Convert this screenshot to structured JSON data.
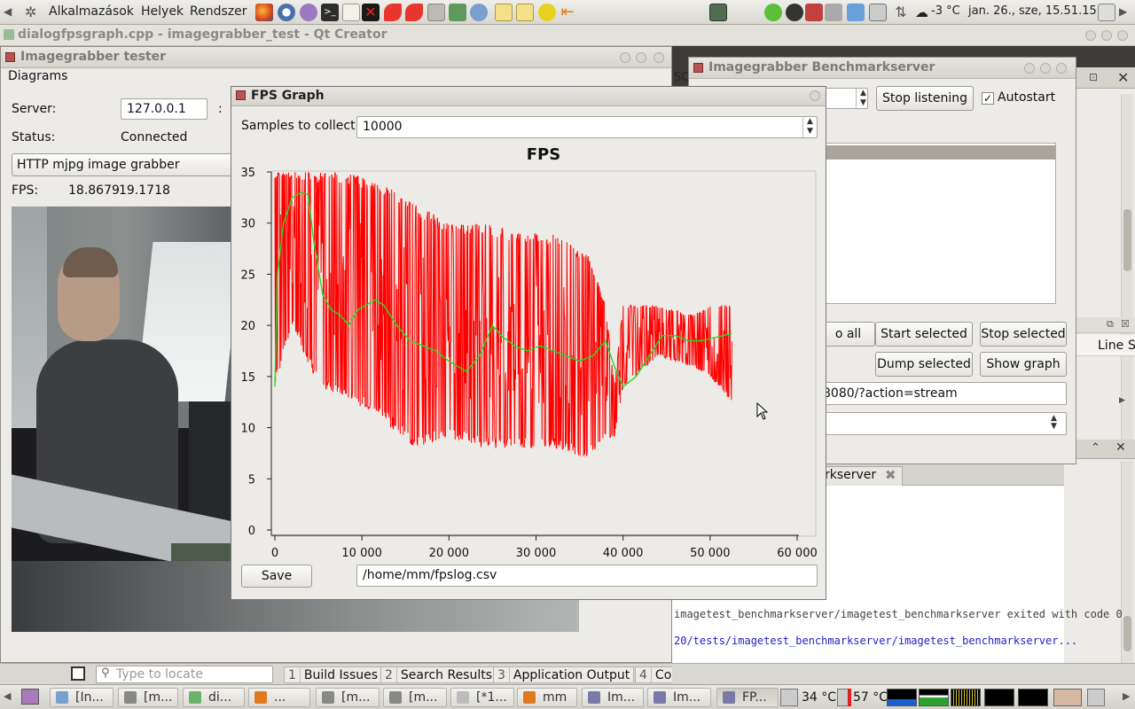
{
  "top_panel": {
    "menus": [
      "Alkalmazások",
      "Helyek",
      "Rendszer"
    ],
    "temperature": "-3 °C",
    "clock": "jan. 26., sze, 15.51.15"
  },
  "qt_creator": {
    "title": "dialogfpsgraph.cpp - imagegrabber_test - Qt Creator"
  },
  "tester": {
    "title": "Imagegrabber tester",
    "menu": "Diagrams",
    "server_label": "Server:",
    "server_value": "127.0.0.1",
    "colon": ":",
    "status_label": "Status:",
    "status_value": "Connected",
    "grabber_select": "HTTP mjpg image grabber",
    "fps_label": "FPS:",
    "fps_value1": "18.8679",
    "fps_value2": "19.1718"
  },
  "benchmark": {
    "title": "Imagegrabber Benchmarkserver",
    "stop_listening": "Stop listening",
    "autostart": "Autostart",
    "stop_all_partial": "o all",
    "start_selected": "Start selected",
    "stop_selected": "Stop selected",
    "dump_selected": "Dump selected",
    "show_graph": "Show graph",
    "url_partial": "8080/?action=stream"
  },
  "right_edge": {
    "tab_partial": "SC",
    "line_col": "Line",
    "s_col": "S"
  },
  "output_panel": {
    "tab_partial": "rkserver",
    "line1": "imagetest_benchmarkserver/imagetest_benchmarkserver exited with code 0",
    "line2": "20/tests/imagetest_benchmarkserver/imagetest_benchmarkserver..."
  },
  "fps_graph": {
    "title": "FPS Graph",
    "samples_label": "Samples to collect:",
    "samples_value": "10000",
    "save_button": "Save",
    "file_path": "/home/mm/fpslog.csv"
  },
  "bottom_bar": {
    "locate_placeholder": "Type to locate",
    "tabs": [
      {
        "num": "1",
        "label": "Build Issues"
      },
      {
        "num": "2",
        "label": "Search Results"
      },
      {
        "num": "3",
        "label": "Application Output"
      },
      {
        "num": "4",
        "label": "Compile Output"
      }
    ]
  },
  "taskbar": {
    "items": [
      "[In...",
      "[m...",
      "di...",
      "...",
      "[m...",
      "[m...",
      "[*1...",
      "mm",
      "Im...",
      "Im...",
      "FP..."
    ],
    "cpu_temp": "34 °C",
    "gpu_temp": "57 °C"
  },
  "chart_data": {
    "type": "line",
    "title": "FPS",
    "xlabel": "",
    "ylabel": "",
    "xlim": [
      0,
      60000
    ],
    "ylim": [
      0,
      35
    ],
    "x_ticks": [
      "0",
      "10 000",
      "20 000",
      "30 000",
      "40 000",
      "50 000",
      "60 000"
    ],
    "y_ticks": [
      "0",
      "5",
      "10",
      "15",
      "20",
      "25",
      "30",
      "35"
    ],
    "colors": {
      "raw": "#ff0000",
      "average": "#22dd22"
    },
    "average_series": {
      "x": [
        0,
        300,
        1000,
        2000,
        3000,
        3800,
        4500,
        5500,
        6500,
        7500,
        8500,
        9500,
        10500,
        11500,
        12500,
        14000,
        15500,
        17000,
        18500,
        20000,
        21000,
        22000,
        23500,
        25000,
        26000,
        27500,
        29000,
        30500,
        32000,
        33500,
        35000,
        36500,
        38000,
        39000,
        40000,
        41500,
        43000,
        44500,
        46000,
        47500,
        49000,
        50500,
        51500,
        52500
      ],
      "values": [
        14,
        25,
        30,
        32.5,
        33,
        32.8,
        28,
        23,
        21.5,
        21,
        20,
        21.5,
        22,
        22.5,
        22,
        20,
        18.5,
        18,
        17.5,
        16.5,
        16,
        15.5,
        17,
        20,
        19,
        18,
        17.5,
        18,
        17.5,
        17,
        16.5,
        17,
        18.5,
        16,
        14,
        15,
        17,
        19,
        19,
        18.5,
        18.5,
        18.8,
        19,
        19.2
      ]
    },
    "raw_series": {
      "description_free": true,
      "x_range": [
        0,
        52500
      ],
      "envelope_x": [
        0,
        2000,
        5000,
        8000,
        12000,
        16000,
        20000,
        24000,
        28000,
        32000,
        36000,
        38000,
        39000,
        40000,
        44000,
        48000,
        50000,
        52500
      ],
      "envelope_min": [
        14,
        20,
        14,
        13,
        11,
        8,
        9,
        8,
        8,
        8,
        7,
        9,
        9,
        14,
        17,
        16,
        15,
        12.5
      ],
      "envelope_max": [
        35,
        35,
        35,
        35,
        34,
        32,
        30,
        30,
        29,
        29,
        27,
        22,
        14,
        22,
        22,
        21,
        22,
        22
      ]
    }
  }
}
